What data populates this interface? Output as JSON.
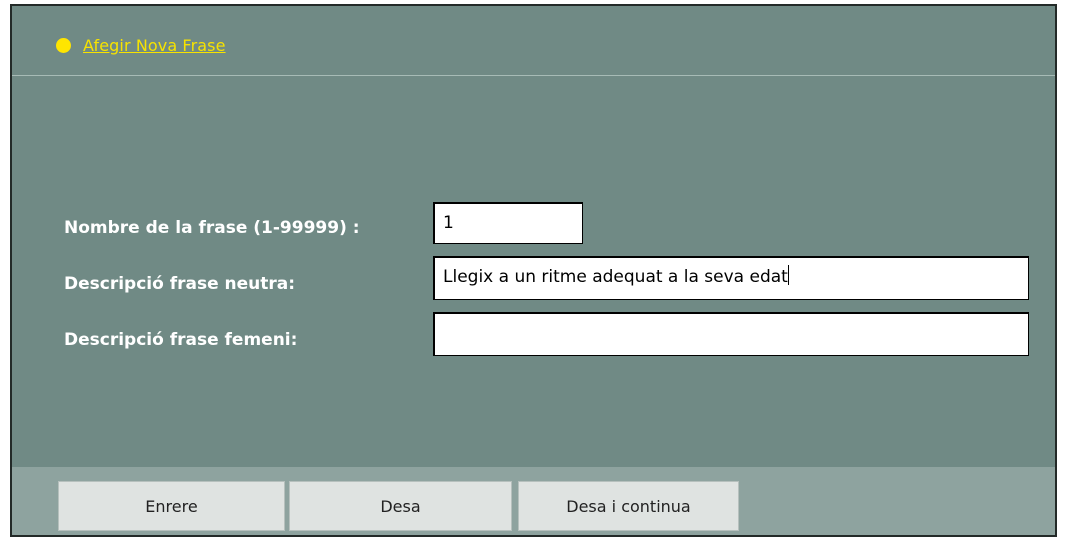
{
  "header": {
    "link_label": "Afegir Nova Frase"
  },
  "form": {
    "number": {
      "label": "Nombre de la frase (1-99999) :",
      "value": "1"
    },
    "neutral": {
      "label": "Descripció frase neutra:",
      "value": "Llegix a un ritme adequat a la seva edat"
    },
    "feminine": {
      "label": "Descripció frase femeni:",
      "value": ""
    }
  },
  "buttons": {
    "back": "Enrere",
    "save": "Desa",
    "save_continue": "Desa i continua"
  },
  "colors": {
    "panel": "#708a85",
    "footer": "#8ea39f",
    "link": "#f7e300",
    "bullet": "#ffe500"
  }
}
